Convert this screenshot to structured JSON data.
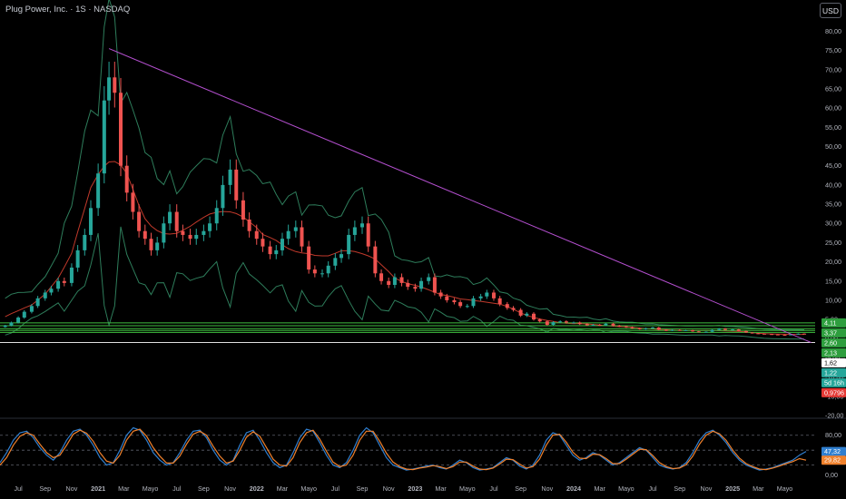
{
  "header": {
    "title": "Plug Power, Inc. · 1S · NASDAQ",
    "currency_button": "USD"
  },
  "colors": {
    "background": "#000000",
    "candle_up": "#26a69a",
    "candle_down": "#ef5350",
    "trendline": "#b44fcf",
    "ma_line": "#c0392b",
    "bands": "#2e7d5b",
    "support_lines": "#3fbf3f",
    "stoch_k": "#2f7fd0",
    "stoch_d": "#f0812c"
  },
  "chart_data": [
    {
      "type": "candlestick",
      "panel": "price",
      "y_ticks": [
        "80,00",
        "75,00",
        "70,00",
        "65,00",
        "60,00",
        "55,00",
        "50,00",
        "45,00",
        "40,00",
        "35,00",
        "30,00",
        "25,00",
        "20,00",
        "15,00",
        "10,00",
        "5,00",
        "0,00",
        "-5,00",
        "-10,00",
        "-15,00",
        "-20,00"
      ],
      "ylim": [
        -20,
        82
      ],
      "x_ticks": [
        "Jul",
        "Sep",
        "Nov",
        "2021",
        "Mar",
        "Mayo",
        "Jul",
        "Sep",
        "Nov",
        "2022",
        "Mar",
        "Mayo",
        "Jul",
        "Sep",
        "Nov",
        "2023",
        "Mar",
        "Mayo",
        "Jul",
        "Sep",
        "Nov",
        "2024",
        "Mar",
        "Mayo",
        "Jul",
        "Sep",
        "Nov",
        "2025",
        "Mar",
        "Mayo"
      ],
      "x_tick_bold": [
        "2021",
        "2022",
        "2023",
        "2024",
        "2025"
      ],
      "x": [
        "2020-06-01",
        "2020-06-15",
        "2020-07-01",
        "2020-07-15",
        "2020-08-01",
        "2020-08-15",
        "2020-09-01",
        "2020-09-15",
        "2020-10-01",
        "2020-10-15",
        "2020-11-01",
        "2020-11-15",
        "2020-12-01",
        "2020-12-15",
        "2021-01-01",
        "2021-01-15",
        "2021-01-26",
        "2021-02-08",
        "2021-02-22",
        "2021-03-08",
        "2021-03-22",
        "2021-04-05",
        "2021-04-19",
        "2021-05-03",
        "2021-05-17",
        "2021-06-01",
        "2021-06-15",
        "2021-07-01",
        "2021-07-15",
        "2021-08-01",
        "2021-08-15",
        "2021-09-01",
        "2021-09-15",
        "2021-10-01",
        "2021-10-15",
        "2021-11-01",
        "2021-11-15",
        "2021-12-01",
        "2021-12-15",
        "2022-01-01",
        "2022-01-15",
        "2022-02-01",
        "2022-02-15",
        "2022-03-01",
        "2022-03-15",
        "2022-04-01",
        "2022-04-15",
        "2022-05-01",
        "2022-05-15",
        "2022-06-01",
        "2022-06-15",
        "2022-07-01",
        "2022-07-15",
        "2022-08-01",
        "2022-08-15",
        "2022-09-01",
        "2022-09-15",
        "2022-10-01",
        "2022-10-15",
        "2022-11-01",
        "2022-11-15",
        "2022-12-01",
        "2022-12-15",
        "2023-01-01",
        "2023-01-15",
        "2023-02-01",
        "2023-02-15",
        "2023-03-01",
        "2023-03-15",
        "2023-04-01",
        "2023-04-15",
        "2023-05-01",
        "2023-05-15",
        "2023-06-01",
        "2023-06-15",
        "2023-07-01",
        "2023-07-15",
        "2023-08-01",
        "2023-08-15",
        "2023-09-01",
        "2023-09-15",
        "2023-10-01",
        "2023-10-15",
        "2023-11-01",
        "2023-11-15",
        "2023-12-01",
        "2023-12-15",
        "2024-01-01",
        "2024-01-15",
        "2024-02-01",
        "2024-02-15",
        "2024-03-01",
        "2024-03-15",
        "2024-04-01",
        "2024-04-15",
        "2024-05-01",
        "2024-05-15",
        "2024-06-01",
        "2024-06-15",
        "2024-07-01",
        "2024-07-15",
        "2024-08-01",
        "2024-08-15",
        "2024-09-01",
        "2024-09-15",
        "2024-10-01",
        "2024-10-15",
        "2024-11-01",
        "2024-11-15",
        "2024-12-01",
        "2024-12-15",
        "2025-01-01",
        "2025-01-15",
        "2025-02-01",
        "2025-02-15",
        "2025-03-01",
        "2025-03-15",
        "2025-04-01",
        "2025-04-15",
        "2025-05-01",
        "2025-05-15",
        "2025-06-01",
        "2025-06-15",
        "2025-07-01"
      ],
      "close": [
        3.4,
        4.2,
        5.5,
        7.0,
        8.5,
        10.5,
        12.0,
        13.0,
        15.0,
        14.5,
        18.5,
        23.0,
        27.0,
        34.0,
        43.0,
        62.0,
        68.0,
        64.0,
        45.0,
        38.0,
        33.0,
        28.0,
        26.0,
        23.0,
        25.0,
        30.0,
        33.0,
        28.0,
        27.0,
        26.0,
        27.0,
        28.0,
        30.0,
        34.0,
        40.0,
        44.0,
        36.0,
        31.0,
        28.0,
        26.0,
        24.0,
        22.0,
        23.0,
        26.0,
        28.0,
        29.0,
        24.0,
        18.0,
        17.0,
        17.0,
        19.0,
        21.0,
        22.0,
        27.0,
        29.0,
        30.0,
        24.0,
        17.0,
        15.0,
        14.0,
        16.0,
        14.5,
        13.5,
        13.0,
        15.0,
        16.0,
        12.0,
        11.0,
        10.0,
        9.5,
        8.5,
        8.5,
        10.5,
        11.0,
        12.0,
        10.5,
        9.0,
        8.0,
        7.5,
        6.0,
        6.5,
        5.0,
        4.5,
        3.6,
        4.3,
        4.5,
        4.2,
        4.2,
        3.8,
        3.5,
        3.6,
        3.5,
        3.9,
        3.4,
        3.2,
        3.0,
        2.7,
        2.5,
        2.7,
        2.9,
        2.3,
        2.1,
        2.3,
        2.2,
        2.2,
        1.9,
        1.8,
        1.8,
        2.3,
        2.6,
        2.3,
        2.4,
        2.0,
        1.6,
        1.4,
        1.3,
        1.2,
        1.1,
        1.0,
        0.98,
        1.1,
        1.3,
        1.22
      ],
      "trendline": {
        "from": {
          "x": "2021-01-26",
          "y": 75.5
        },
        "to": {
          "x": "2025-07-01",
          "y": -1.0
        }
      },
      "horizontal_levels": [
        4.11,
        3.37,
        2.6,
        2.13,
        1.62,
        -1.0
      ],
      "price_labels": [
        {
          "text": "4,11",
          "value": 4.11,
          "bg": "#2e9e3e",
          "fg": "#ffffff"
        },
        {
          "text": "3,37",
          "value": 3.37,
          "bg": "#2e9e3e",
          "fg": "#ffffff"
        },
        {
          "text": "2,60",
          "value": 2.6,
          "bg": "#2e9e3e",
          "fg": "#ffffff"
        },
        {
          "text": "2,13",
          "value": 2.13,
          "bg": "#2e9e3e",
          "fg": "#ffffff"
        },
        {
          "text": "1,62",
          "value": 1.62,
          "bg": "#ffffff",
          "fg": "#000000"
        },
        {
          "text": "1,22",
          "value": 1.22,
          "bg": "#26a69a",
          "fg": "#ffffff"
        },
        {
          "text": "5d 16h",
          "value": 1.22,
          "bg": "#26a69a",
          "fg": "#ffffff"
        },
        {
          "text": "0,9796",
          "value": 0.98,
          "bg": "#e53935",
          "fg": "#ffffff"
        }
      ]
    },
    {
      "type": "line",
      "panel": "stochastic",
      "y_ticks": [
        "80,00",
        "47,32",
        "29,82",
        "0,00"
      ],
      "ylim": [
        -8,
        105
      ],
      "reference_levels": [
        80,
        50,
        20
      ],
      "series": [
        {
          "name": "%K",
          "value_label": "47,32",
          "label_bg": "#2f7fd0",
          "values": [
            25,
            45,
            70,
            85,
            88,
            75,
            55,
            40,
            30,
            45,
            70,
            88,
            92,
            80,
            60,
            35,
            20,
            25,
            50,
            80,
            95,
            90,
            70,
            45,
            30,
            20,
            25,
            45,
            70,
            88,
            90,
            75,
            50,
            30,
            20,
            30,
            60,
            85,
            90,
            70,
            45,
            25,
            15,
            20,
            45,
            75,
            92,
            88,
            65,
            40,
            20,
            15,
            25,
            50,
            80,
            95,
            85,
            60,
            35,
            20,
            15,
            10,
            12,
            15,
            18,
            20,
            15,
            12,
            20,
            30,
            25,
            15,
            10,
            12,
            15,
            25,
            35,
            30,
            18,
            12,
            20,
            40,
            70,
            85,
            80,
            60,
            40,
            30,
            35,
            45,
            40,
            30,
            20,
            25,
            35,
            45,
            55,
            50,
            35,
            20,
            15,
            12,
            15,
            25,
            45,
            70,
            85,
            90,
            80,
            65,
            45,
            30,
            20,
            15,
            10,
            12,
            15,
            20,
            25,
            30,
            40,
            47.32
          ]
        },
        {
          "name": "%D",
          "value_label": "29,82",
          "label_bg": "#f0812c",
          "values": [
            20,
            35,
            60,
            78,
            85,
            80,
            62,
            45,
            35,
            40,
            60,
            82,
            90,
            84,
            68,
            45,
            28,
            24,
            40,
            70,
            88,
            92,
            78,
            55,
            38,
            24,
            24,
            38,
            62,
            82,
            88,
            80,
            58,
            38,
            24,
            28,
            50,
            76,
            87,
            78,
            55,
            32,
            20,
            18,
            35,
            65,
            85,
            90,
            72,
            48,
            26,
            17,
            20,
            40,
            70,
            88,
            88,
            68,
            44,
            26,
            17,
            12,
            11,
            14,
            16,
            19,
            17,
            13,
            17,
            26,
            26,
            18,
            12,
            11,
            14,
            22,
            32,
            31,
            22,
            14,
            17,
            32,
            60,
            80,
            82,
            66,
            46,
            34,
            33,
            42,
            41,
            33,
            23,
            23,
            32,
            42,
            52,
            51,
            39,
            25,
            17,
            13,
            14,
            21,
            38,
            62,
            80,
            88,
            83,
            70,
            50,
            34,
            23,
            17,
            12,
            11,
            14,
            18,
            23,
            27,
            33,
            29.82
          ]
        }
      ],
      "x_ticks": [
        "Jul",
        "Sep",
        "Nov",
        "2021",
        "Mar",
        "Mayo",
        "Jul",
        "Sep",
        "Nov",
        "2022",
        "Mar",
        "Mayo",
        "Jul",
        "Sep",
        "Nov",
        "2023",
        "Mar",
        "Mayo",
        "Jul",
        "Sep",
        "Nov",
        "2024",
        "Mar",
        "Mayo",
        "Jul",
        "Sep",
        "Nov",
        "2025",
        "Mar",
        "Mayo"
      ]
    }
  ]
}
